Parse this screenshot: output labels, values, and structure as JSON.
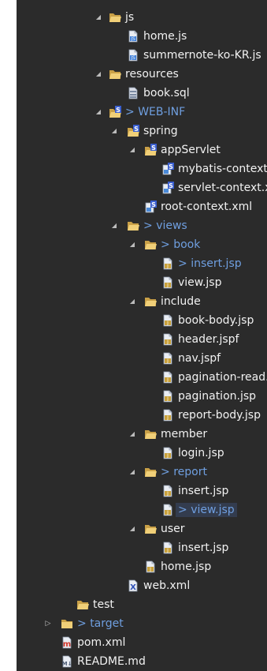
{
  "tree": {
    "nodes": [
      {
        "label": "js",
        "kind": "folder",
        "depth": 0,
        "expanded": true
      },
      {
        "label": "home.js",
        "kind": "jsfile",
        "depth": 1
      },
      {
        "label": "summernote-ko-KR.js",
        "kind": "jsfile",
        "depth": 1
      },
      {
        "label": "resources",
        "kind": "folder",
        "depth": 0,
        "expanded": true
      },
      {
        "label": "book.sql",
        "kind": "sqlfile",
        "depth": 1
      },
      {
        "label": "WEB-INF",
        "kind": "springfolder",
        "depth": 0,
        "expanded": true,
        "dirty": true
      },
      {
        "label": "spring",
        "kind": "springfolder",
        "depth": 1,
        "expanded": true
      },
      {
        "label": "appServlet",
        "kind": "springfolder",
        "depth": 2,
        "expanded": true
      },
      {
        "label": "mybatis-context.xml",
        "kind": "springxml",
        "depth": 3
      },
      {
        "label": "servlet-context.xml",
        "kind": "springxml",
        "depth": 3
      },
      {
        "label": "root-context.xml",
        "kind": "springxml",
        "depth": 2
      },
      {
        "label": "views",
        "kind": "folder",
        "depth": 1,
        "expanded": true,
        "dirty": true
      },
      {
        "label": "book",
        "kind": "folder",
        "depth": 2,
        "expanded": true,
        "dirty": true
      },
      {
        "label": "insert.jsp",
        "kind": "jsp",
        "depth": 3,
        "dirty": true
      },
      {
        "label": "view.jsp",
        "kind": "jsp",
        "depth": 3
      },
      {
        "label": "include",
        "kind": "folder",
        "depth": 2,
        "expanded": true
      },
      {
        "label": "book-body.jsp",
        "kind": "jsp",
        "depth": 3
      },
      {
        "label": "header.jspf",
        "kind": "jsp",
        "depth": 3
      },
      {
        "label": "nav.jspf",
        "kind": "jsp",
        "depth": 3
      },
      {
        "label": "pagination-read.jsp",
        "kind": "jsp",
        "depth": 3
      },
      {
        "label": "pagination.jsp",
        "kind": "jsp",
        "depth": 3
      },
      {
        "label": "report-body.jsp",
        "kind": "jsp",
        "depth": 3
      },
      {
        "label": "member",
        "kind": "folder",
        "depth": 2,
        "expanded": true
      },
      {
        "label": "login.jsp",
        "kind": "jsp",
        "depth": 3
      },
      {
        "label": "report",
        "kind": "folder",
        "depth": 2,
        "expanded": true,
        "dirty": true
      },
      {
        "label": "insert.jsp",
        "kind": "jsp",
        "depth": 3
      },
      {
        "label": "view.jsp",
        "kind": "jsp",
        "depth": 3,
        "dirty": true,
        "selected": true
      },
      {
        "label": "user",
        "kind": "folder",
        "depth": 2,
        "expanded": true
      },
      {
        "label": "insert.jsp",
        "kind": "jsp",
        "depth": 3
      },
      {
        "label": "home.jsp",
        "kind": "jsp",
        "depth": 2
      },
      {
        "label": "web.xml",
        "kind": "webxml",
        "depth": 1
      },
      {
        "label": "test",
        "kind": "folder",
        "depth": -1
      },
      {
        "label": "target",
        "kind": "folder",
        "depth": -2,
        "expanded": false,
        "dirty": true
      },
      {
        "label": "pom.xml",
        "kind": "pom",
        "depth": -2
      },
      {
        "label": "README.md",
        "kind": "md",
        "depth": -2
      }
    ]
  },
  "colors": {
    "background": "#2b2b2b",
    "text": "#f2f2f2",
    "dirty_text": "#6f9fe0",
    "selection": "#333c4e",
    "folder": "#e8c16b"
  },
  "icons": {
    "folder": "folder-icon",
    "jsfile": "js-file-icon",
    "sqlfile": "sql-file-icon",
    "springfolder": "spring-folder-icon",
    "springxml": "spring-xml-icon",
    "jsp": "jsp-file-icon",
    "webxml": "web-xml-icon",
    "pom": "maven-pom-icon",
    "md": "markdown-file-icon"
  }
}
